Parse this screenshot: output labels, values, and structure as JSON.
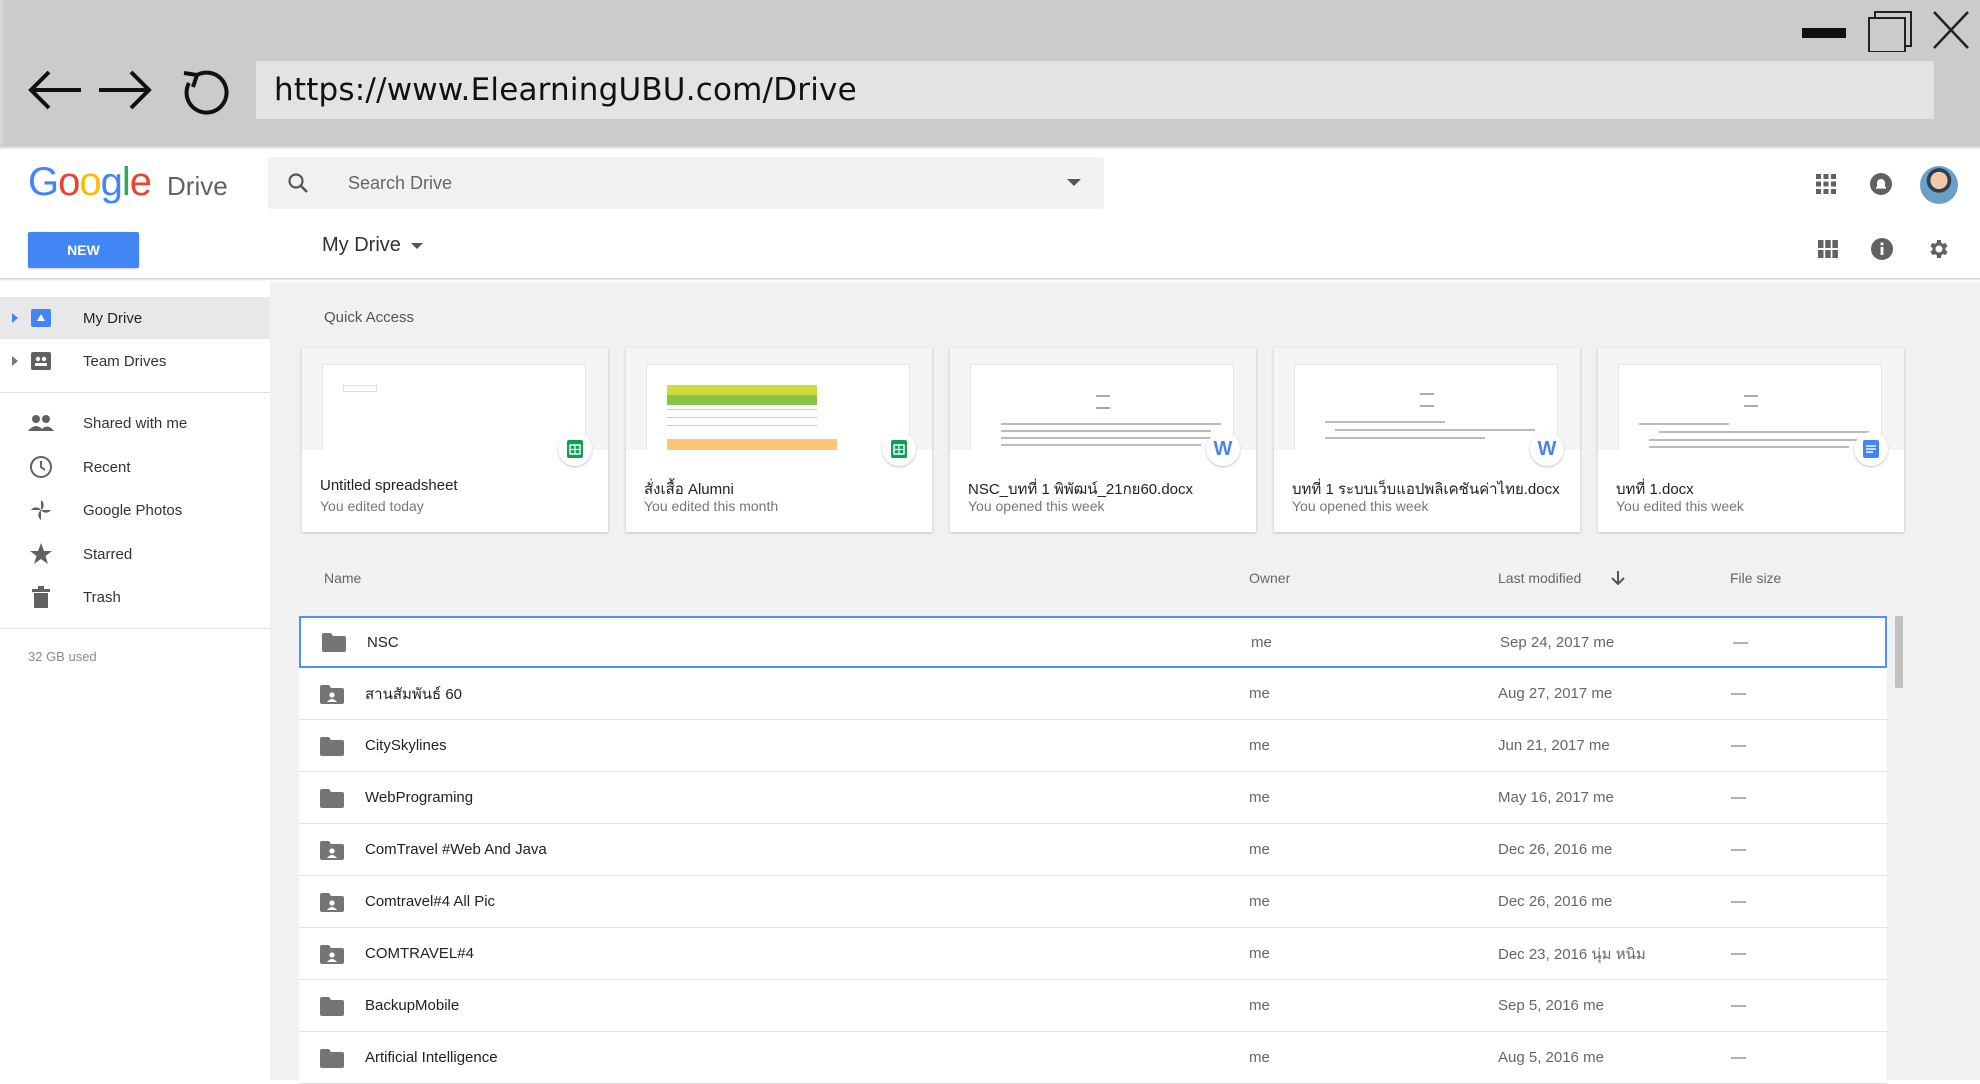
{
  "browser": {
    "url": "https://www.ElearningUBU.com/Drive",
    "minimize_icon": "minimize-icon",
    "maximize_icon": "maximize-icon",
    "close_icon": "close-icon",
    "back_icon": "back-arrow-icon",
    "forward_icon": "forward-arrow-icon",
    "reload_icon": "reload-icon"
  },
  "header": {
    "logo_google": "Google",
    "logo_drive": "Drive",
    "search_placeholder": "Search Drive",
    "new_label": "NEW",
    "location_title": "My Drive"
  },
  "sidebar": {
    "items": [
      {
        "label": "My Drive",
        "icon": "drive-icon",
        "active": true
      },
      {
        "label": "Team Drives",
        "icon": "team-drives-icon"
      },
      {
        "label": "Shared with me",
        "icon": "shared-icon"
      },
      {
        "label": "Recent",
        "icon": "clock-icon"
      },
      {
        "label": "Google Photos",
        "icon": "photos-icon"
      },
      {
        "label": "Starred",
        "icon": "star-icon"
      },
      {
        "label": "Trash",
        "icon": "trash-icon"
      }
    ],
    "storage": "32 GB used"
  },
  "quick_access": {
    "title": "Quick Access",
    "cards": [
      {
        "name": "Untitled spreadsheet",
        "meta": "You edited today",
        "type": "sheets"
      },
      {
        "name": "สั่งเสื้อ Alumni",
        "meta": "You edited this month",
        "type": "sheets"
      },
      {
        "name": "NSC_บทที่ 1 พิพัฒน์_21กย60.docx",
        "meta": "You opened this week",
        "type": "word"
      },
      {
        "name": "บทที่ 1 ระบบเว็บแอปพลิเคชันค่าไทย.docx",
        "meta": "You opened this week",
        "type": "word"
      },
      {
        "name": "บทที่ 1.docx",
        "meta": "You edited this week",
        "type": "docs"
      }
    ]
  },
  "list": {
    "columns": {
      "name": "Name",
      "owner": "Owner",
      "modified": "Last modified",
      "size": "File size"
    },
    "rows": [
      {
        "name": "NSC",
        "owner": "me",
        "modified": "Sep 24, 2017 me",
        "size": "—",
        "shared": false
      },
      {
        "name": "สานสัมพันธ์ 60",
        "owner": "me",
        "modified": "Aug 27, 2017 me",
        "size": "—",
        "shared": true
      },
      {
        "name": "CitySkylines",
        "owner": "me",
        "modified": "Jun 21, 2017 me",
        "size": "—",
        "shared": false
      },
      {
        "name": "WebPrograming",
        "owner": "me",
        "modified": "May 16, 2017 me",
        "size": "—",
        "shared": false
      },
      {
        "name": "ComTravel #Web And Java",
        "owner": "me",
        "modified": "Dec 26, 2016 me",
        "size": "—",
        "shared": true
      },
      {
        "name": "Comtravel#4 All Pic",
        "owner": "me",
        "modified": "Dec 26, 2016 me",
        "size": "—",
        "shared": true
      },
      {
        "name": "COMTRAVEL#4",
        "owner": "me",
        "modified": "Dec 23, 2016 นุ่ม หนิม",
        "size": "—",
        "shared": true
      },
      {
        "name": "BackupMobile",
        "owner": "me",
        "modified": "Sep 5, 2016 me",
        "size": "—",
        "shared": false
      },
      {
        "name": "Artificial Intelligence",
        "owner": "me",
        "modified": "Aug 5, 2016 me",
        "size": "—",
        "shared": false
      }
    ]
  },
  "colors": {
    "accent": "#4285f4",
    "sheets": "#0f9d58",
    "word": "#4a86e8",
    "docs": "#4285f4"
  }
}
